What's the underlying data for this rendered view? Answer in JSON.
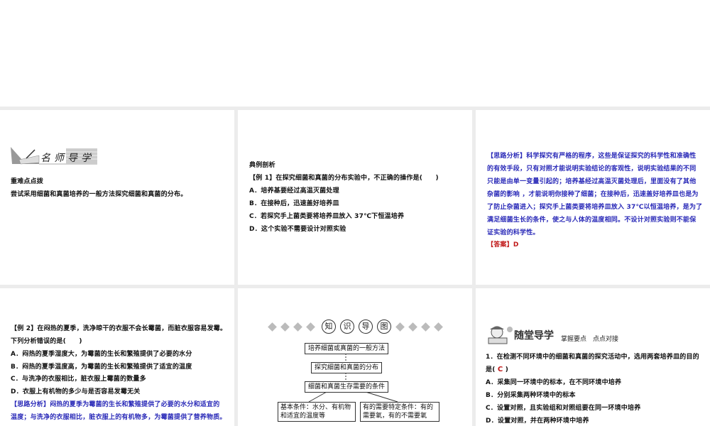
{
  "panel1": {
    "banner_text": "名师导学",
    "heading": "重难点点拨",
    "body": "尝试采用细菌和真菌培养的一般方法探究细菌和真菌的分布。"
  },
  "panel2": {
    "heading": "典例剖析",
    "question": "【例 1】在探究细菌和真菌的分布实验中，不正确的操作是(　　)",
    "options": [
      "A．培养基要经过高温灭菌处理",
      "B．在接种后，迅速盖好培养皿",
      "C．若探究手上菌类要将培养皿放入 37℃下恒温培养",
      "D．这个实验不需要设计对照实验"
    ]
  },
  "panel3": {
    "analysis_lines": [
      "【思路分析】科学探究有严格的程序，这些是保证探究的科学性和准确性",
      "的有效手段，只有对照才能说明实验结论的客观性，说明实验结果的不同",
      "只能是由单一变量引起的；培养基经过高温灭菌处理后，里面没有了其他",
      "杂菌的影响 ，才能说明你接种了细菌；在接种后，迅速盖好培养皿也是为",
      "了防止杂菌进入；探究手上菌类要将培养皿放入 37℃以恒温培养，是为了",
      "满足细菌生长的条件，使之与人体的温度相同。不设计对照实验则不能保",
      "证实验的科学性。"
    ],
    "answer_label": "【答案】",
    "answer": "D"
  },
  "panel4": {
    "question_lines": [
      "【例 2】在闷热的夏季，洗净晾干的衣服不会长霉菌，而脏衣服容易发霉。",
      "下列分析错误的是(　　)"
    ],
    "options": [
      "A．闷热的夏季湿度大，为霉菌的生长和繁殖提供了必要的水分",
      "B．闷热的夏季温度高，为霉菌的生长和繁殖提供了适宜的温度",
      "C．与洗净的衣服相比，脏衣服上霉菌的数量多",
      "D．衣服上有机物的多少与是否容易发霉无关"
    ],
    "analysis_lines": [
      "【思路分析】闷热的夏季为霉菌的生长和繁殖提供了必要的水分和适宜的",
      "温度；与洗净的衣服相比，脏衣服上的有机物多，为霉菌提供了营养物质。"
    ]
  },
  "panel5": {
    "title_chars": [
      "知",
      "识",
      "导",
      "图"
    ],
    "boxes": {
      "method": "培养细菌或真菌的一般方法",
      "explore": "探究细菌和真菌的分布",
      "conditions": "细菌和真菌生存需要的条件",
      "basic_1": "基本条件：水分、有机物",
      "basic_2": "和适宜的温度等",
      "special_1": "有的需要特定条件：有的",
      "special_2": "需要氧，有的不需要氧"
    }
  },
  "panel6": {
    "banner_title": "随堂导学",
    "banner_sub": "掌握要点　点点对接",
    "question_line1": "1．在检测不同环境中的细菌和真菌的探究活动中，选用两套培养皿的目的",
    "question_line2_prefix": "是(",
    "answer": "C",
    "question_line2_suffix": ")",
    "options": [
      "A．采集同一环境中的标本，在不同环境中培养",
      "B．分别采集两种环境中的标本",
      "C．设置对照，且实验组和对照组要在同一环境中培养",
      "D．设置对照，并在两种环境中培养"
    ]
  }
}
